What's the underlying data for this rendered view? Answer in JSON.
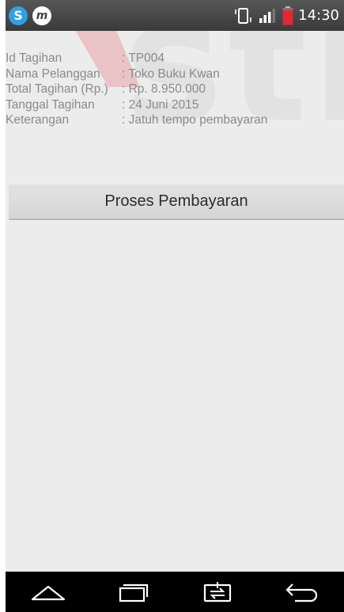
{
  "status_bar": {
    "time": "14:30",
    "app_icons": [
      "s-app-icon",
      "m-app-icon"
    ],
    "icons": [
      "vibrate-icon",
      "signal-icon",
      "battery-icon"
    ],
    "battery_color": "#e0283a"
  },
  "details": {
    "rows": [
      {
        "label": "Id Tagihan",
        "value": ": TP004"
      },
      {
        "label": "Nama Pelanggan",
        "value": ": Toko Buku Kwan"
      },
      {
        "label": "Total Tagihan (Rp.)",
        "value": ": Rp. 8.950.000"
      },
      {
        "label": "Tanggal Tagihan",
        "value": ": 24 Juni 2015"
      },
      {
        "label": "Keterangan",
        "value": ": Jatuh tempo pembayaran"
      }
    ]
  },
  "button": {
    "label": "Proses Pembayaran"
  },
  "nav_bar": {
    "icons": [
      "home-icon",
      "recent-apps-icon",
      "dual-window-icon",
      "back-icon"
    ]
  }
}
